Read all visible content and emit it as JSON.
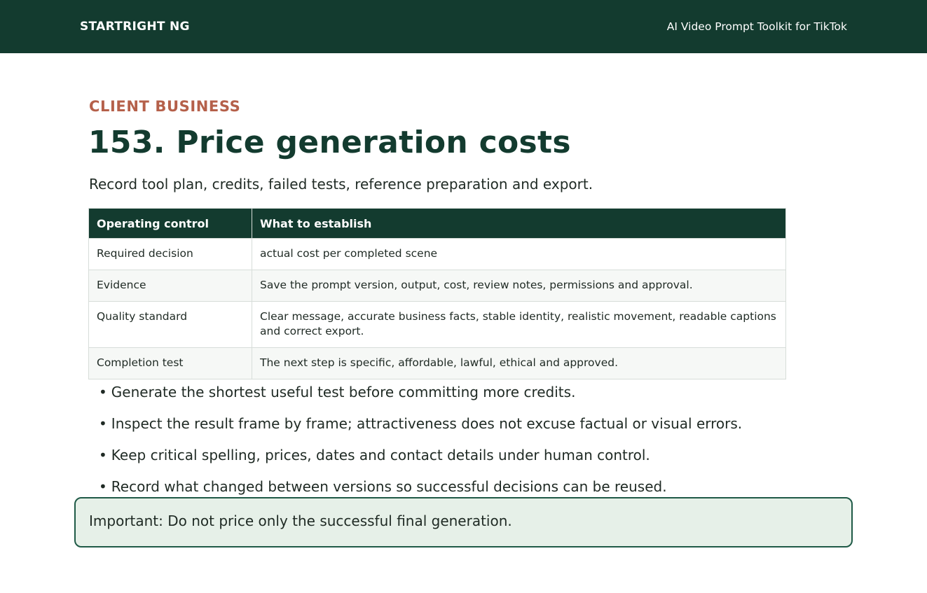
{
  "header": {
    "brand": "STARTRIGHT NG",
    "title": "AI Video Prompt Toolkit for TikTok"
  },
  "section": {
    "eyebrow": "CLIENT BUSINESS",
    "heading": "153. Price generation costs",
    "intro": "Record tool plan, credits, failed tests, reference preparation and export."
  },
  "table": {
    "headers": [
      "Operating control",
      "What to establish"
    ],
    "rows": [
      [
        "Required decision",
        "actual cost per completed scene"
      ],
      [
        "Evidence",
        "Save the prompt version, output, cost, review notes, permissions and approval."
      ],
      [
        "Quality standard",
        "Clear message, accurate business facts, stable identity, realistic movement, readable captions and correct export."
      ],
      [
        "Completion test",
        "The next step is specific, affordable, lawful, ethical and approved."
      ]
    ]
  },
  "tips": [
    "Generate the shortest useful test before committing more credits.",
    "Inspect the result frame by frame; attractiveness does not excuse factual or visual errors.",
    "Keep critical spelling, prices, dates and contact details under human control.",
    "Record what changed between versions so successful decisions can be reused."
  ],
  "callout": "Important: Do not price only the successful final generation.",
  "colors": {
    "primary": "#133b2f",
    "accent": "#b5604a",
    "callout_bg": "#e6f0e8"
  }
}
